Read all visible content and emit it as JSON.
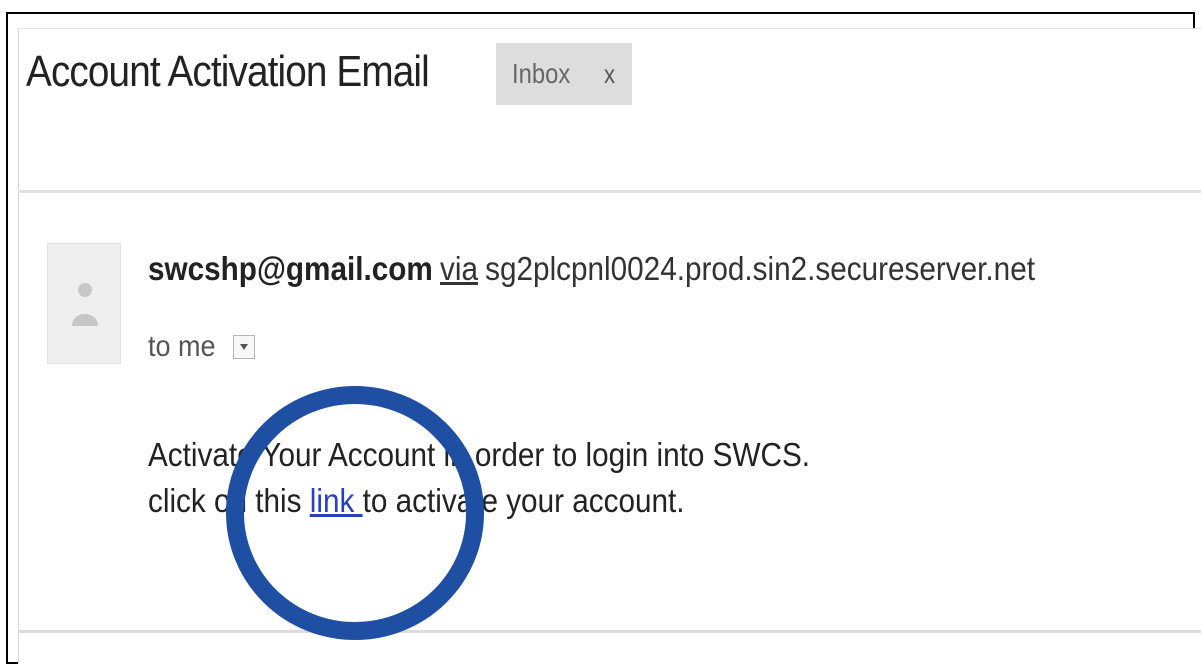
{
  "email": {
    "subject": "Account Activation Email",
    "label_chip": {
      "label": "Inbox",
      "close": "x"
    },
    "sender": {
      "email": "swcshp@gmail.com",
      "via_label": "via",
      "relay_host": "sg2plcpnl0024.prod.sin2.secureserver.net"
    },
    "recipient_line": "to me",
    "body": {
      "line1": "Activate Your Account in order to login into SWCS.",
      "line2_before": "click on this ",
      "link_text": "link ",
      "line2_after": "to activate your account."
    }
  },
  "annotation": {
    "highlight_color": "#1f4fa3"
  },
  "icons": {
    "avatar": "person-placeholder-icon",
    "dropdown": "caret-down-icon"
  }
}
